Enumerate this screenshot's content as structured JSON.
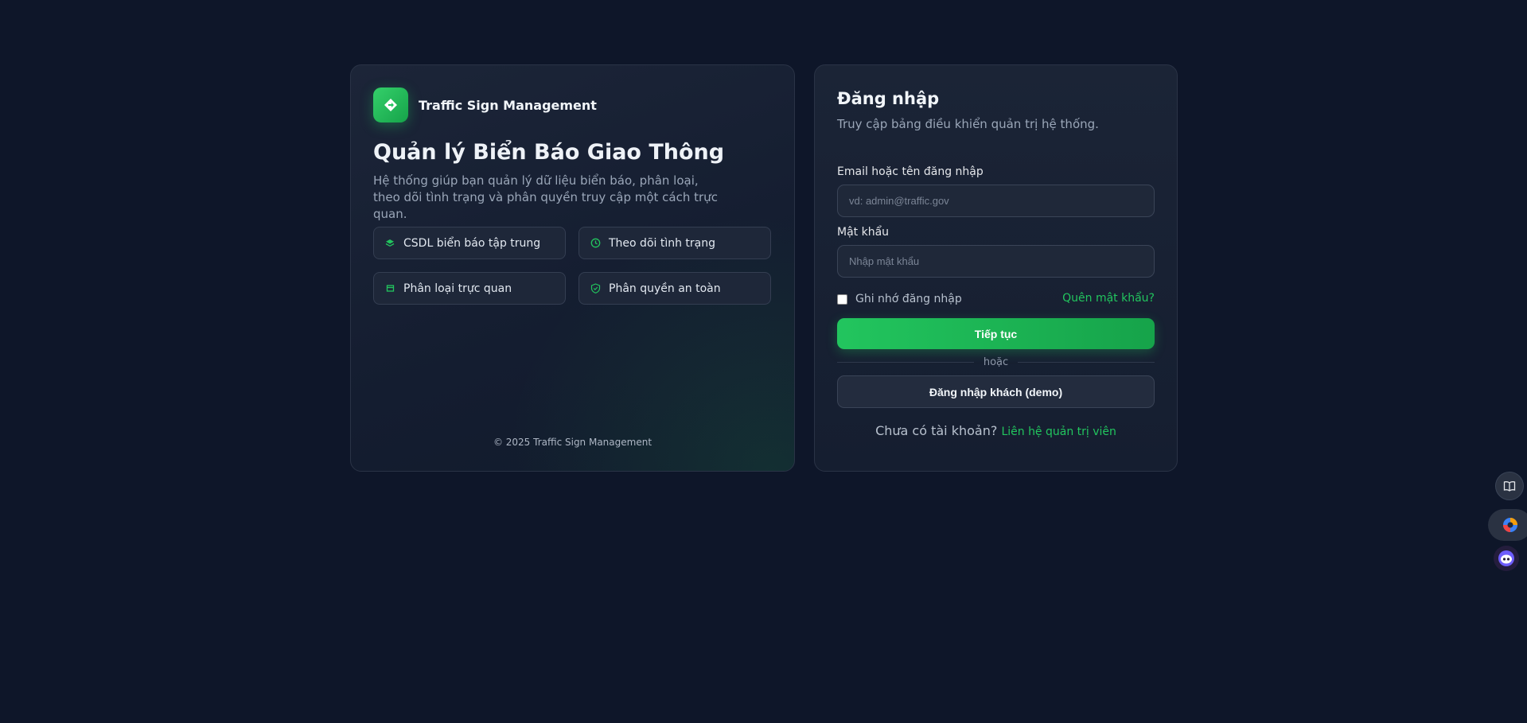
{
  "brand": {
    "name": "Traffic Sign Management",
    "accent_color": "#22c55e"
  },
  "hero": {
    "title": "Quản lý Biển Báo Giao Thông",
    "description": "Hệ thống giúp bạn quản lý dữ liệu biển báo, phân loại, theo dõi tình trạng và phân quyền truy cập một cách trực quan."
  },
  "features": [
    {
      "label": "CSDL biển báo tập trung",
      "icon": "layers-icon"
    },
    {
      "label": "Theo dõi tình trạng",
      "icon": "clock-icon"
    },
    {
      "label": "Phân loại trực quan",
      "icon": "category-icon"
    },
    {
      "label": "Phân quyền an toàn",
      "icon": "shield-check-icon"
    }
  ],
  "footer": {
    "copyright": "© 2025 Traffic Sign Management"
  },
  "login": {
    "title": "Đăng nhập",
    "subtitle": "Truy cập bảng điều khiển quản trị hệ thống.",
    "email_label": "Email hoặc tên đăng nhập",
    "email_placeholder": "vd: admin@traffic.gov",
    "email_value": "",
    "password_label": "Mật khẩu",
    "password_placeholder": "Nhập mật khẩu",
    "password_value": "",
    "remember_label": "Ghi nhớ đăng nhập",
    "remember_checked": false,
    "forgot_link": "Quên mật khẩu?",
    "submit_label": "Tiếp tục",
    "divider_text": "hoặc",
    "guest_label": "Đăng nhập khách (demo)",
    "no_account_text": "Chưa có tài khoản?",
    "contact_link": "Liên hệ quản trị viên"
  },
  "floating_tools": [
    {
      "name": "book-icon"
    },
    {
      "name": "assistant-icon"
    },
    {
      "name": "bot-icon"
    }
  ]
}
